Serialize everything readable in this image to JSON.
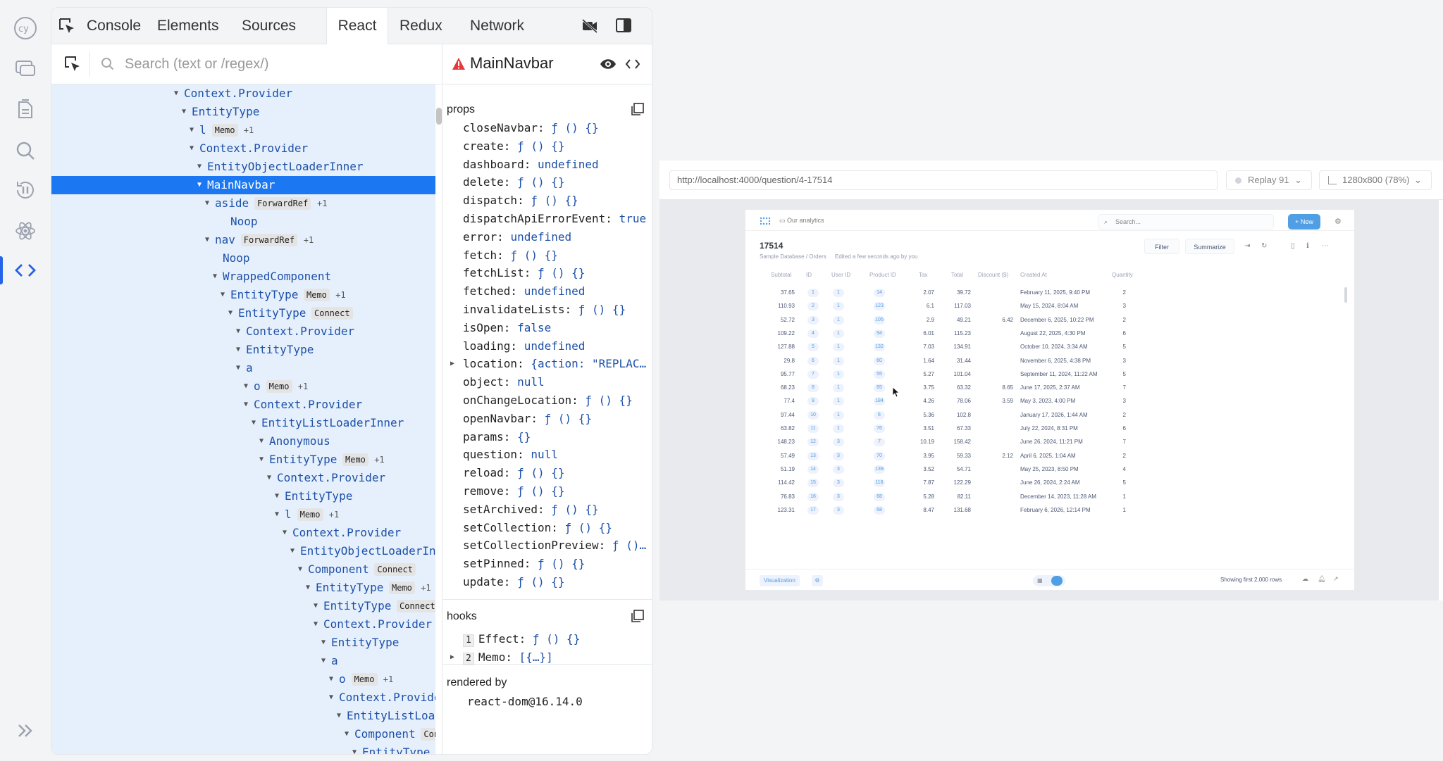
{
  "sidebar": {
    "items": [
      {
        "name": "cypress-logo-icon"
      },
      {
        "name": "chat-icon"
      },
      {
        "name": "files-icon"
      },
      {
        "name": "search-icon"
      },
      {
        "name": "pause-replay-icon"
      },
      {
        "name": "react-icon"
      },
      {
        "name": "code-icon"
      }
    ],
    "expand_icon": "double-chevron-right-icon"
  },
  "devtools": {
    "tabs": [
      "Console",
      "Elements",
      "Sources",
      "React",
      "Redux",
      "Network"
    ],
    "active_tab": "React",
    "search_placeholder": "Search (text or /regex/)",
    "tree": [
      {
        "name": "Context.Provider"
      },
      {
        "name": "EntityType"
      },
      {
        "name": "l",
        "badge": "Memo",
        "plus": "+1"
      },
      {
        "name": "Context.Provider"
      },
      {
        "name": "EntityObjectLoaderInner"
      },
      {
        "name": "MainNavbar",
        "selected": true
      },
      {
        "name": "aside",
        "badge": "ForwardRef",
        "plus": "+1"
      },
      {
        "name": "Noop",
        "leaf": true
      },
      {
        "name": "nav",
        "badge": "ForwardRef",
        "plus": "+1"
      },
      {
        "name": "Noop",
        "leaf": true
      },
      {
        "name": "WrappedComponent"
      },
      {
        "name": "EntityType",
        "badge": "Memo",
        "plus": "+1"
      },
      {
        "name": "EntityType",
        "badge": "Connect"
      },
      {
        "name": "Context.Provider"
      },
      {
        "name": "EntityType"
      },
      {
        "name": "a"
      },
      {
        "name": "o",
        "badge": "Memo",
        "plus": "+1"
      },
      {
        "name": "Context.Provider"
      },
      {
        "name": "EntityListLoaderInner"
      },
      {
        "name": "Anonymous"
      },
      {
        "name": "EntityType",
        "badge": "Memo",
        "plus": "+1"
      },
      {
        "name": "Context.Provider"
      },
      {
        "name": "EntityType"
      },
      {
        "name": "l",
        "badge": "Memo",
        "plus": "+1"
      },
      {
        "name": "Context.Provider"
      },
      {
        "name": "EntityObjectLoaderInner"
      },
      {
        "name": "Component",
        "badge": "Connect"
      },
      {
        "name": "EntityType",
        "badge": "Memo",
        "plus": "+1"
      },
      {
        "name": "EntityType",
        "badge": "Connect"
      },
      {
        "name": "Context.Provider"
      },
      {
        "name": "EntityType"
      },
      {
        "name": "a"
      },
      {
        "name": "o",
        "badge": "Memo",
        "plus": "+1"
      },
      {
        "name": "Context.Provider"
      },
      {
        "name": "EntityListLoaderInner"
      },
      {
        "name": "Component",
        "badge": "Connect"
      },
      {
        "name": "EntityType",
        "badge": "Memo",
        "plus": "+1"
      }
    ],
    "tree_indent_steps": [
      18,
      19,
      20,
      20,
      21,
      21,
      22,
      24,
      22,
      23,
      23,
      24,
      25,
      26,
      26,
      26,
      27,
      27,
      28,
      29,
      29,
      30,
      31,
      31,
      32,
      33,
      34,
      35,
      36,
      36,
      37,
      37,
      38,
      38,
      39,
      40,
      41
    ],
    "component": {
      "title": "MainNavbar",
      "props_label": "props",
      "props": [
        {
          "key": "closeNavbar:",
          "value": "ƒ () {}"
        },
        {
          "key": "create:",
          "value": "ƒ () {}"
        },
        {
          "key": "dashboard:",
          "value": "undefined"
        },
        {
          "key": "delete:",
          "value": "ƒ () {}"
        },
        {
          "key": "dispatch:",
          "value": "ƒ () {}"
        },
        {
          "key": "dispatchApiErrorEvent:",
          "value": "true"
        },
        {
          "key": "error:",
          "value": "undefined"
        },
        {
          "key": "fetch:",
          "value": "ƒ () {}"
        },
        {
          "key": "fetchList:",
          "value": "ƒ () {}"
        },
        {
          "key": "fetched:",
          "value": "undefined"
        },
        {
          "key": "invalidateLists:",
          "value": "ƒ () {}"
        },
        {
          "key": "isOpen:",
          "value": "false"
        },
        {
          "key": "loading:",
          "value": "undefined"
        },
        {
          "key": "location:",
          "value": "{action: \"REPLAC…",
          "expandable": true
        },
        {
          "key": "object:",
          "value": "null"
        },
        {
          "key": "onChangeLocation:",
          "value": "ƒ () {}"
        },
        {
          "key": "openNavbar:",
          "value": "ƒ () {}"
        },
        {
          "key": "params:",
          "value": "{}"
        },
        {
          "key": "question:",
          "value": "null"
        },
        {
          "key": "reload:",
          "value": "ƒ () {}"
        },
        {
          "key": "remove:",
          "value": "ƒ () {}"
        },
        {
          "key": "setArchived:",
          "value": "ƒ () {}"
        },
        {
          "key": "setCollection:",
          "value": "ƒ () {}"
        },
        {
          "key": "setCollectionPreview:",
          "value": "ƒ ()…"
        },
        {
          "key": "setPinned:",
          "value": "ƒ () {}"
        },
        {
          "key": "update:",
          "value": "ƒ () {}"
        }
      ],
      "hooks_label": "hooks",
      "hooks": [
        {
          "index": "1",
          "key": "Effect:",
          "value": "ƒ () {}"
        },
        {
          "index": "2",
          "key": "Memo:",
          "value": "[{…}]",
          "expandable": true
        }
      ],
      "rendered_by_label": "rendered by",
      "rendered_by": "react-dom@16.14.0"
    }
  },
  "browser": {
    "url": "http://localhost:4000/question/4-17514",
    "replay": "Replay 91",
    "viewport_size": "1280x800 (78%)"
  },
  "app": {
    "collection": "Our analytics",
    "search_placeholder": "Search...",
    "new_button": "+ New",
    "question_title": "17514",
    "breadcrumb": [
      "Sample Database",
      "/",
      "Orders"
    ],
    "edited": "Edited a few seconds ago by you",
    "filter": "Filter",
    "summarize": "Summarize",
    "columns": [
      "Subtotal",
      "ID",
      "User ID",
      "Product ID",
      "Tax",
      "Total",
      "Discount ($)",
      "Created At",
      "Quantity"
    ],
    "rows": [
      [
        "37.65",
        "1",
        "1",
        "14",
        "2.07",
        "39.72",
        "",
        "February 11, 2025, 9:40 PM",
        "2"
      ],
      [
        "110.93",
        "2",
        "1",
        "123",
        "6.1",
        "117.03",
        "",
        "May 15, 2024, 8:04 AM",
        "3"
      ],
      [
        "52.72",
        "3",
        "1",
        "105",
        "2.9",
        "49.21",
        "6.42",
        "December 6, 2025, 10:22 PM",
        "2"
      ],
      [
        "109.22",
        "4",
        "1",
        "94",
        "6.01",
        "115.23",
        "",
        "August 22, 2025, 4:30 PM",
        "6"
      ],
      [
        "127.88",
        "5",
        "1",
        "132",
        "7.03",
        "134.91",
        "",
        "October 10, 2024, 3:34 AM",
        "5"
      ],
      [
        "29.8",
        "6",
        "1",
        "60",
        "1.64",
        "31.44",
        "",
        "November 6, 2025, 4:38 PM",
        "3"
      ],
      [
        "95.77",
        "7",
        "1",
        "55",
        "5.27",
        "101.04",
        "",
        "September 11, 2024, 11:22 AM",
        "5"
      ],
      [
        "68.23",
        "8",
        "1",
        "65",
        "3.75",
        "63.32",
        "8.65",
        "June 17, 2025, 2:37 AM",
        "7"
      ],
      [
        "77.4",
        "9",
        "1",
        "184",
        "4.26",
        "78.06",
        "3.59",
        "May 3, 2023, 4:00 PM",
        "3"
      ],
      [
        "97.44",
        "10",
        "1",
        "6",
        "5.36",
        "102.8",
        "",
        "January 17, 2026, 1:44 AM",
        "2"
      ],
      [
        "63.82",
        "11",
        "1",
        "76",
        "3.51",
        "67.33",
        "",
        "July 22, 2024, 8:31 PM",
        "6"
      ],
      [
        "148.23",
        "12",
        "3",
        "7",
        "10.19",
        "158.42",
        "",
        "June 26, 2024, 11:21 PM",
        "7"
      ],
      [
        "57.49",
        "13",
        "3",
        "70",
        "3.95",
        "59.33",
        "2.12",
        "April 6, 2025, 1:04 AM",
        "2"
      ],
      [
        "51.19",
        "14",
        "3",
        "139",
        "3.52",
        "54.71",
        "",
        "May 25, 2023, 8:50 PM",
        "4"
      ],
      [
        "114.42",
        "15",
        "3",
        "116",
        "7.87",
        "122.29",
        "",
        "June 26, 2024, 2:24 AM",
        "5"
      ],
      [
        "76.83",
        "16",
        "3",
        "68",
        "5.28",
        "82.11",
        "",
        "December 14, 2023, 11:28 AM",
        "1"
      ],
      [
        "123.31",
        "17",
        "3",
        "68",
        "8.47",
        "131.68",
        "",
        "February 6, 2026, 12:14 PM",
        "1"
      ]
    ],
    "visualization": "Visualization",
    "row_count": "Showing first 2,000 rows"
  },
  "colors": {
    "accent": "#2563eb",
    "selected_row": "#1b78f2",
    "tree_bg": "#e6f0fc",
    "metabase_blue": "#509ee3"
  }
}
